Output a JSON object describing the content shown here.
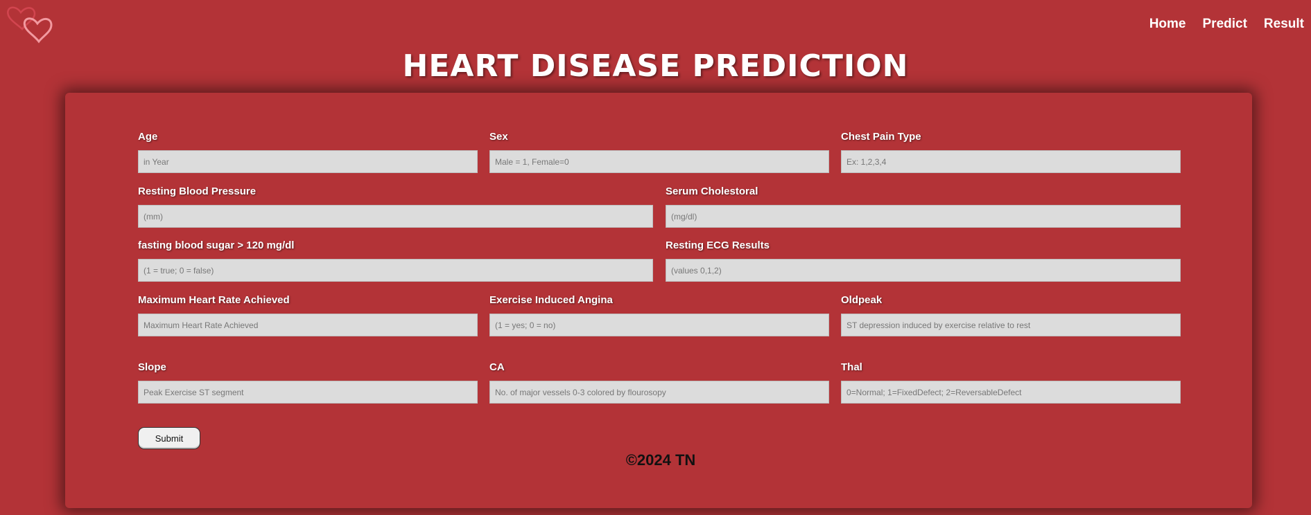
{
  "logo": {
    "icon": "hearts-icon",
    "colors": [
      "#e8737a",
      "#d94a55"
    ]
  },
  "nav": [
    {
      "label": "Home"
    },
    {
      "label": "Predict"
    },
    {
      "label": "Result"
    }
  ],
  "page_title": "HEART DISEASE PREDICTION",
  "form": {
    "age": {
      "label": "Age",
      "placeholder": "in Year",
      "value": ""
    },
    "sex": {
      "label": "Sex",
      "placeholder": "Male = 1, Female=0",
      "value": ""
    },
    "cp": {
      "label": "Chest Pain Type",
      "placeholder": "Ex: 1,2,3,4",
      "value": ""
    },
    "trestbps": {
      "label": "Resting Blood Pressure",
      "placeholder": "(mm)",
      "value": ""
    },
    "chol": {
      "label": "Serum Cholestoral",
      "placeholder": "(mg/dl)",
      "value": ""
    },
    "fbs": {
      "label": "fasting blood sugar > 120 mg/dl",
      "placeholder": "(1 = true; 0 = false)",
      "value": ""
    },
    "restecg": {
      "label": "Resting ECG Results",
      "placeholder": "(values 0,1,2)",
      "value": ""
    },
    "thalach": {
      "label": "Maximum Heart Rate Achieved",
      "placeholder": "Maximum Heart Rate Achieved",
      "value": ""
    },
    "exang": {
      "label": "Exercise Induced Angina",
      "placeholder": "(1 = yes; 0 = no)",
      "value": ""
    },
    "oldpeak": {
      "label": "Oldpeak",
      "placeholder": "ST depression induced by exercise relative to rest",
      "value": ""
    },
    "slope": {
      "label": "Slope",
      "placeholder": "Peak Exercise ST segment",
      "value": ""
    },
    "ca": {
      "label": "CA",
      "placeholder": "No. of major vessels 0-3 colored by flourosopy",
      "value": ""
    },
    "thal": {
      "label": "Thal",
      "placeholder": "0=Normal; 1=FixedDefect; 2=ReversableDefect",
      "value": ""
    },
    "submit_label": "Submit"
  },
  "footer": "©2024 TN",
  "colors": {
    "background": "#b33337",
    "input_bg": "#dcdcdc"
  }
}
